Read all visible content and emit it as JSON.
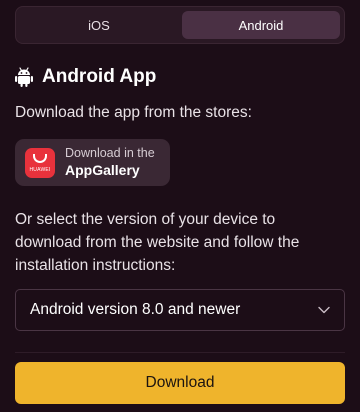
{
  "tabs": [
    {
      "label": "iOS",
      "active": false
    },
    {
      "label": "Android",
      "active": true
    }
  ],
  "heading": {
    "icon": "android-icon",
    "title": "Android App"
  },
  "subtitle": "Download the app from the stores:",
  "store": {
    "icon": "huawei-appgallery-icon",
    "logo_text": "HUAWEI",
    "small_label": "Download in the",
    "name": "AppGallery"
  },
  "instructions": "Or select the version of your device to download from the website and follow the installation instructions:",
  "version_select": {
    "selected": "Android version 8.0 and newer",
    "icon": "chevron-down-icon"
  },
  "download_button": {
    "label": "Download"
  },
  "colors": {
    "background": "#1c0d17",
    "accent": "#efb42c",
    "huawei_red": "#e8323c"
  }
}
